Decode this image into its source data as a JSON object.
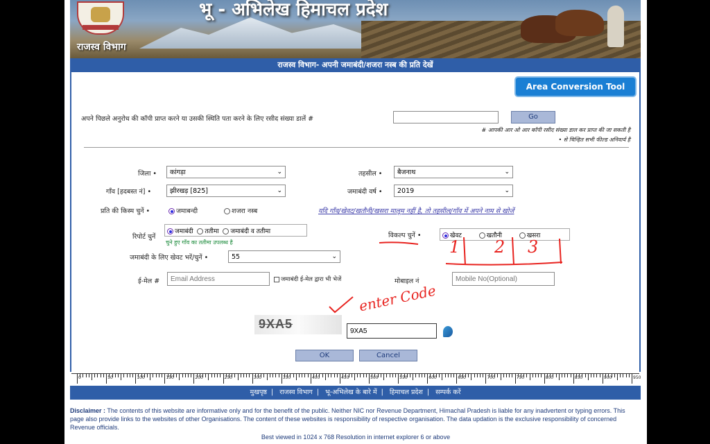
{
  "header": {
    "site_title": "भू - अभिलेख हिमाचल प्रदेश",
    "department": "राजस्व विभाग",
    "heading": "राजस्व विभाग- अपनी जमाबंदी/शजरा नस्ब की प्रति देखें"
  },
  "tools": {
    "area_conversion_label": "Area Conversion Tool"
  },
  "receipt": {
    "prompt": "अपने पिछले अनुरोध की कॉपी प्राप्त करने या उसकी स्थिति पता करने के लिए रसीद संख्या डालें #",
    "value": "",
    "go_label": "Go",
    "note_1": "# आपकी आर ओ आर कॉपी रसीद संख्या डाल कर प्राप्त की जा सकती है",
    "note_2": "• से चिन्हित सभी फील्ड अनिवार्य है"
  },
  "form": {
    "district_label": "जिला •",
    "district_value": "कांगड़ा",
    "tehsil_label": "तहसील •",
    "tehsil_value": "बैजनाथ",
    "village_label": "गाँव [हदबस्त नं] •",
    "village_value": "झीरखड़ [825]",
    "year_label": "जमाबंदी वर्ष •",
    "year_value": "2019",
    "copy_type_label": "प्रति की किस्म चुनें •",
    "copy_type_options": [
      "जमाबन्दी",
      "शजरा नस्ब"
    ],
    "help_link": "यदि गाँव/खेवट/खतौनी/खसरा मालूम नहीं है, तो तहसील/गाँव में अपने नाम से खोजें",
    "report_label": "रिपोर्ट चुनें",
    "report_options": [
      "जमाबंदी",
      "ततीमा",
      "जमाबंदी व ततीमा"
    ],
    "report_note": "चुने हुए गाँव का ततीमा उपलब्ध है",
    "option_label": "विकल्प चुनें •",
    "option_choices": [
      "खेवट",
      "खतौनी",
      "खसरा"
    ],
    "khewat_label": "जमाबंदी के लिए खेवट भरें/चुनें •",
    "khewat_value": "55",
    "email_label": "ई-मेल #",
    "email_placeholder": "Email Address",
    "email_checkbox_label": "जमाबंदी ई-मेल द्वारा भी भेजें",
    "mobile_label": "मोबाइल नं",
    "mobile_placeholder": "Mobile No(Optional)",
    "captcha_text": "9XA5",
    "captcha_value": "9XA5",
    "ok_label": "OK",
    "cancel_label": "Cancel"
  },
  "annotations": {
    "enter_code": "enter Code",
    "num_1": "1",
    "num_2": "2",
    "num_3": "3"
  },
  "ruler_ticks": [
    "0",
    "50",
    "100",
    "150",
    "200",
    "250",
    "300",
    "350",
    "400",
    "450",
    "500",
    "550",
    "600",
    "650",
    "700",
    "750",
    "800",
    "850",
    "900",
    "950"
  ],
  "footer_nav": [
    "मुखपृष्ठ",
    "राजस्व विभाग",
    "भू-अभिलेख के बारे में",
    "हिमाचल प्रदेश",
    "सम्पर्क करें"
  ],
  "disclaimer_title": "Disclaimer :",
  "disclaimer_text": "The contents of this website are informative only and for the benefit of the public. Neither NIC nor Revenue Department, Himachal Pradesh is liable for any inadvertent or typing errors. This page also provide links to the websites of other Organisations. The content of these websites is responsibility of respective organisation. The data updation is the exclusive responsibility of concerned Revenue officials.",
  "best_viewed": "Best viewed in 1024 x 768 Resolution in internet explorer 6 or above",
  "colors": {
    "brand_blue": "#2f5ea8",
    "button_blue": "#1a7fd4",
    "annotation_red": "#e8231f"
  }
}
